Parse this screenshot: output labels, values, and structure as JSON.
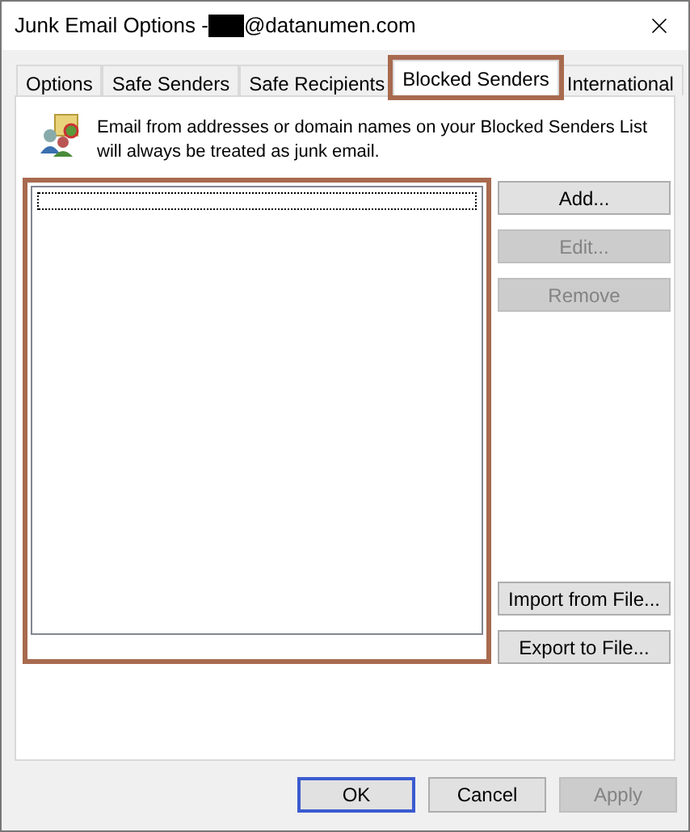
{
  "window": {
    "title_prefix": "Junk Email Options - ",
    "title_suffix": "@datanumen.com",
    "redacted": true
  },
  "tabs": [
    {
      "label": "Options",
      "selected": false,
      "highlighted": false
    },
    {
      "label": "Safe Senders",
      "selected": false,
      "highlighted": false
    },
    {
      "label": "Safe Recipients",
      "selected": false,
      "highlighted": false
    },
    {
      "label": "Blocked Senders",
      "selected": true,
      "highlighted": true
    },
    {
      "label": "International",
      "selected": false,
      "highlighted": false
    }
  ],
  "description": "Email from addresses or domain names on your Blocked Senders List will always be treated as junk email.",
  "sender_list": {
    "highlighted": true
  },
  "side_buttons_top": [
    {
      "label": "Add...",
      "disabled": false
    },
    {
      "label": "Edit...",
      "disabled": true
    },
    {
      "label": "Remove",
      "disabled": true
    }
  ],
  "side_buttons_bottom": [
    {
      "label": "Import from File...",
      "disabled": false
    },
    {
      "label": "Export to File...",
      "disabled": false
    }
  ],
  "footer_buttons": [
    {
      "label": "OK",
      "disabled": false,
      "default": true
    },
    {
      "label": "Cancel",
      "disabled": false,
      "default": false
    },
    {
      "label": "Apply",
      "disabled": true,
      "default": false
    }
  ]
}
